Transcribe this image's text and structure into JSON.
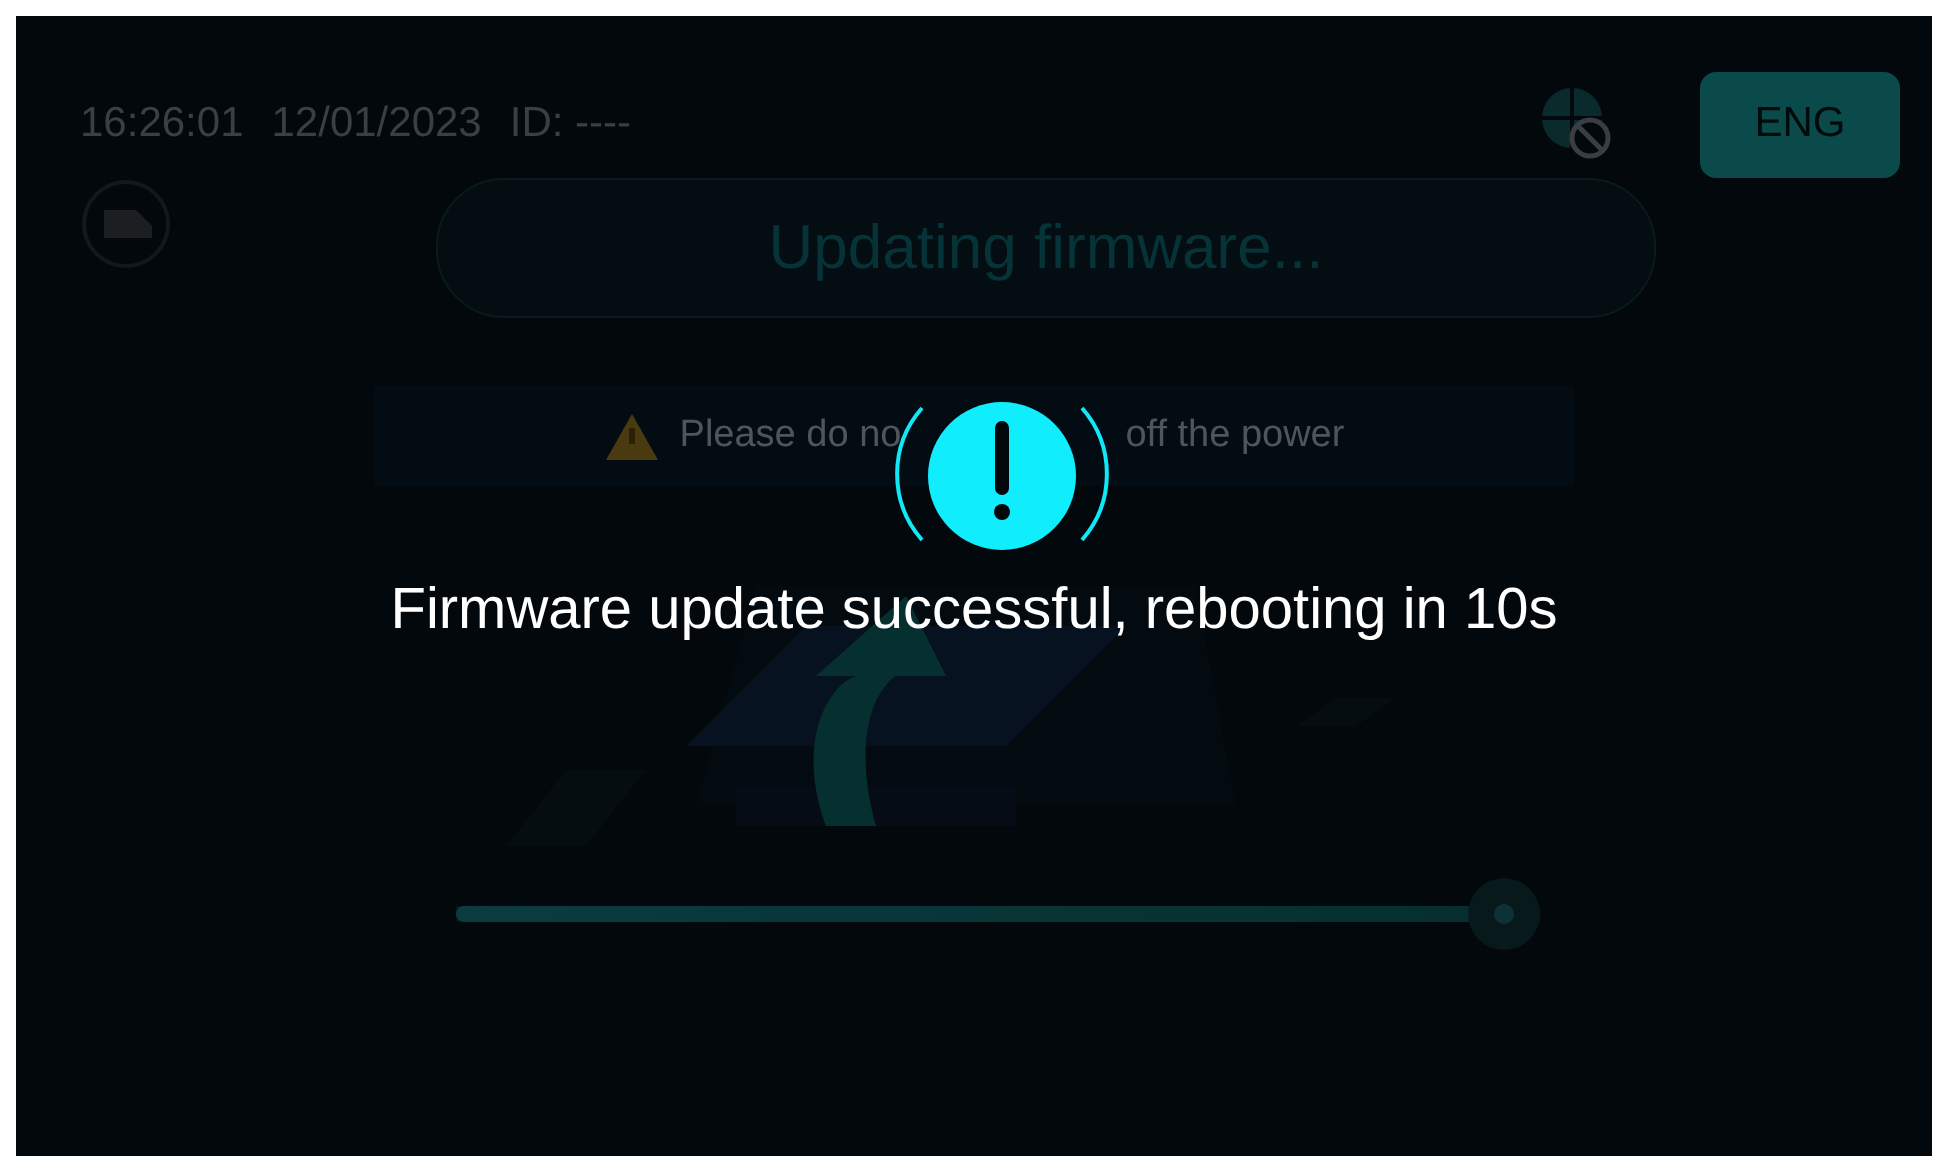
{
  "status_bar": {
    "time": "16:26:01",
    "date": "12/01/2023",
    "id": "ID: ----"
  },
  "language_button": "ENG",
  "title": "Updating firmware...",
  "warning": {
    "text_before": "Please do no",
    "text_after": "off the power"
  },
  "progress": {
    "level": 0.97
  },
  "dialog": {
    "message": "Firmware update successful, rebooting in 10s"
  }
}
